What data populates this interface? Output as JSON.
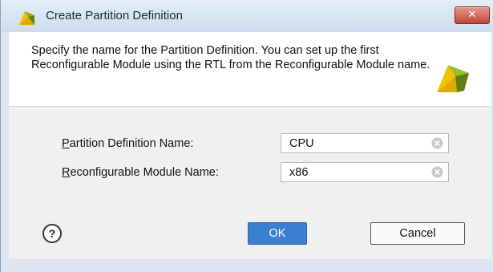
{
  "dialog": {
    "title": "Create Partition Definition",
    "description": "Specify the name for the Partition Definition. You can set up the first Reconfigurable Module using the RTL from the Reconfigurable Module name."
  },
  "form": {
    "partition": {
      "label_mnemonic": "P",
      "label_rest": "artition Definition Name:",
      "value": "CPU"
    },
    "module": {
      "label_mnemonic": "R",
      "label_rest": "econfigurable Module Name:",
      "value": "x86"
    }
  },
  "buttons": {
    "help": "?",
    "ok": "OK",
    "cancel": "Cancel"
  },
  "icons": {
    "title": "vivado-logo-icon",
    "header": "vivado-logo-icon",
    "close": "close-icon",
    "clear": "clear-field-icon"
  },
  "colors": {
    "ok_button": "#3c7ecf",
    "close_button": "#c3453a",
    "logo_yellow": "#f2c200",
    "logo_green": "#6a8b12"
  },
  "close_symbol": "✕"
}
